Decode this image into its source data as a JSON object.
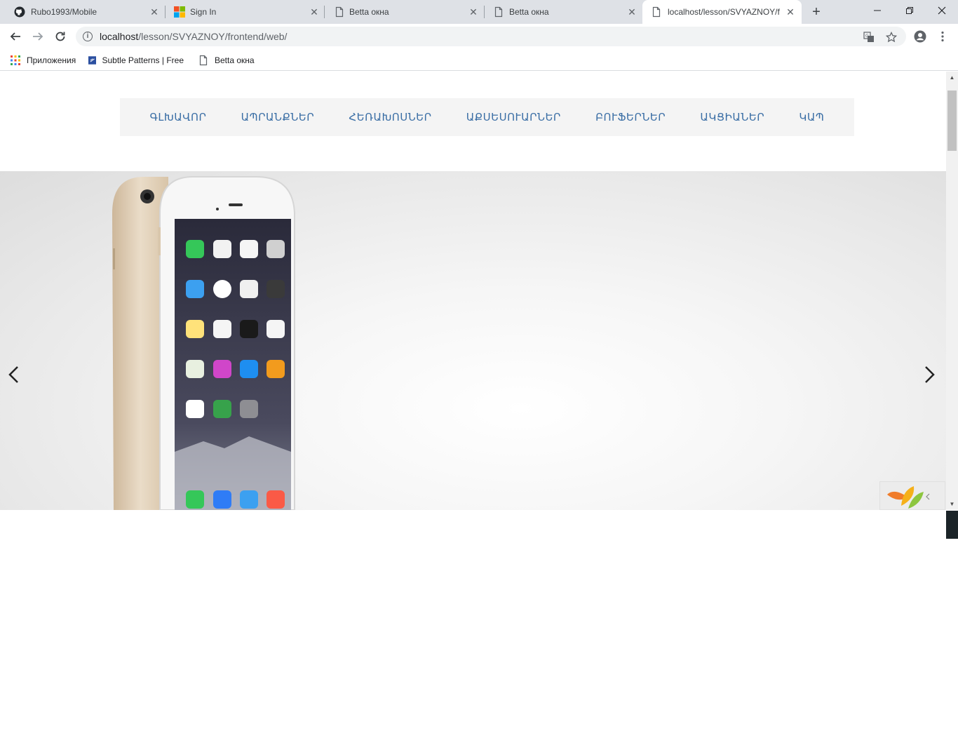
{
  "tabs": [
    {
      "title": "Rubo1993/Mobile",
      "icon": "github-icon",
      "active": false
    },
    {
      "title": "Sign In",
      "icon": "microsoft-icon",
      "active": false
    },
    {
      "title": "Betta окна",
      "icon": "page-icon",
      "active": false
    },
    {
      "title": "Betta окна",
      "icon": "page-icon",
      "active": false
    },
    {
      "title": "localhost/lesson/SVYAZNOY/fr",
      "icon": "page-icon",
      "active": true
    }
  ],
  "window": {
    "new_tab": "+",
    "minimize": "—",
    "restore": "❐",
    "close": "✕"
  },
  "toolbar": {
    "url_host": "localhost",
    "url_path": "/lesson/SVYAZNOY/frontend/web/"
  },
  "bookmarks": [
    {
      "label": "Приложения",
      "icon": "apps-grid-icon"
    },
    {
      "label": "Subtle Patterns | Free",
      "icon": "subtle-patterns-icon"
    },
    {
      "label": "Betta окна",
      "icon": "page-icon"
    }
  ],
  "site_nav": [
    "ԳԼԽԱՎՈՐ",
    "ԱՊՐԱՆՔՆԵՐ",
    "ՀԵՌԱԽՈՍՆԵՐ",
    "ԱՔՍԵՍՈՒԱՐՆԵՐ",
    "ԲՈՒՖԵՐՆԵՐ",
    "ԱԿՑԻԱՆԵՐ",
    "ԿԱՊ"
  ],
  "colors": {
    "nav_link": "#3a6ea5",
    "nav_bg": "#f4f4f4",
    "tabstrip": "#dee1e6"
  }
}
